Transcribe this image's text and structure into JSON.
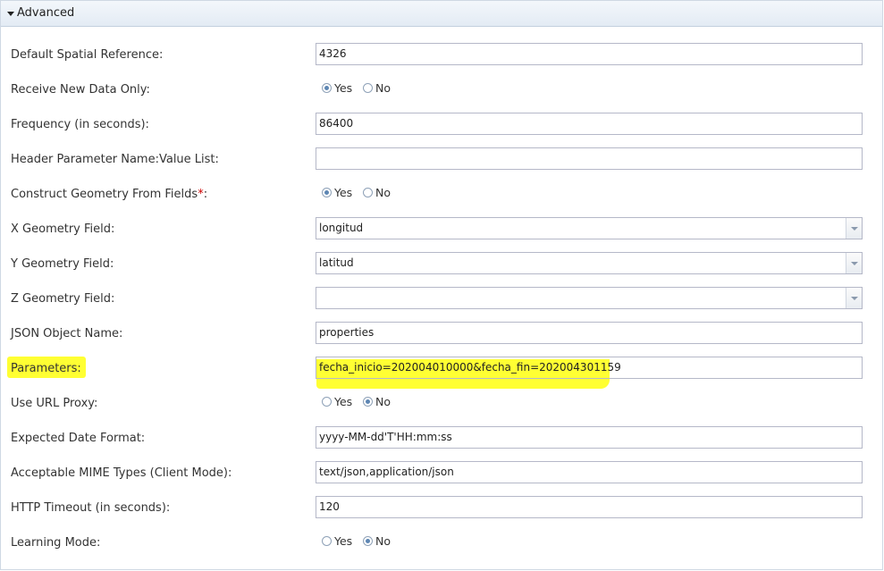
{
  "panel": {
    "title": "Advanced"
  },
  "fields": [
    {
      "label": "Default Spatial Reference:",
      "value": "4326"
    },
    {
      "label": "Receive New Data Only:",
      "yes": "Yes",
      "no": "No",
      "selected": "Yes"
    },
    {
      "label": "Frequency (in seconds):",
      "value": "86400"
    },
    {
      "label": "Header Parameter Name:Value List:",
      "value": ""
    },
    {
      "label": "Construct Geometry From Fields",
      "required_mark": "*",
      "label_suffix": ":",
      "yes": "Yes",
      "no": "No",
      "selected": "Yes"
    },
    {
      "label": "X Geometry Field:",
      "value": "longitud"
    },
    {
      "label": "Y Geometry Field:",
      "value": "latitud"
    },
    {
      "label": "Z Geometry Field:",
      "value": ""
    },
    {
      "label": "JSON Object Name:",
      "value": "properties"
    },
    {
      "label": "Parameters:",
      "value": "fecha_inicio=202004010000&fecha_fin=202004301159"
    },
    {
      "label": "Use URL Proxy:",
      "yes": "Yes",
      "no": "No",
      "selected": "No"
    },
    {
      "label": "Expected Date Format:",
      "value": "yyyy-MM-dd'T'HH:mm:ss"
    },
    {
      "label": "Acceptable MIME Types (Client Mode):",
      "value": "text/json,application/json"
    },
    {
      "label": "HTTP Timeout (in seconds):",
      "value": "120"
    },
    {
      "label": "Learning Mode:",
      "yes": "Yes",
      "no": "No",
      "selected": "No"
    }
  ],
  "colors": {
    "highlight": "#ffff33",
    "required": "#cc0000",
    "header_bg": "#e3ebf4",
    "field_border": "#b5b8c8"
  }
}
